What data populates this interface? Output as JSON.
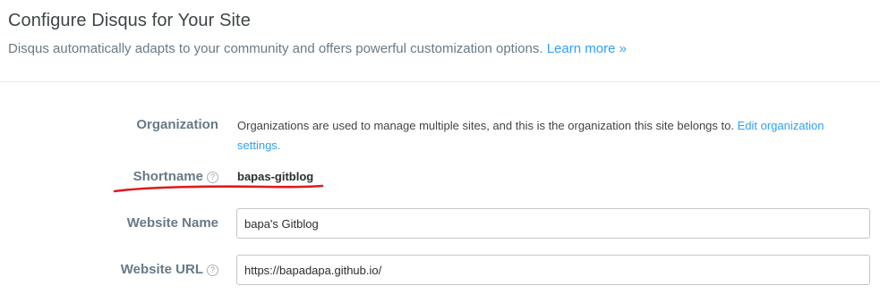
{
  "header": {
    "title": "Configure Disqus for Your Site",
    "subtitle": "Disqus automatically adapts to your community and offers powerful customization options.",
    "learn_more": "Learn more »"
  },
  "form": {
    "organization": {
      "label": "Organization",
      "description": "Organizations are used to manage multiple sites, and this is the organization this site belongs to.",
      "link": "Edit organization settings."
    },
    "shortname": {
      "label": "Shortname",
      "help": "?",
      "value": "bapas-gitblog"
    },
    "website_name": {
      "label": "Website Name",
      "value": "bapa's Gitblog"
    },
    "website_url": {
      "label": "Website URL",
      "help": "?",
      "value": "https://bapadapa.github.io/"
    }
  },
  "annotation": {
    "underline_color": "#e0191e"
  },
  "colors": {
    "link": "#2e9fff",
    "label": "#687a86",
    "title": "#3f4548"
  }
}
